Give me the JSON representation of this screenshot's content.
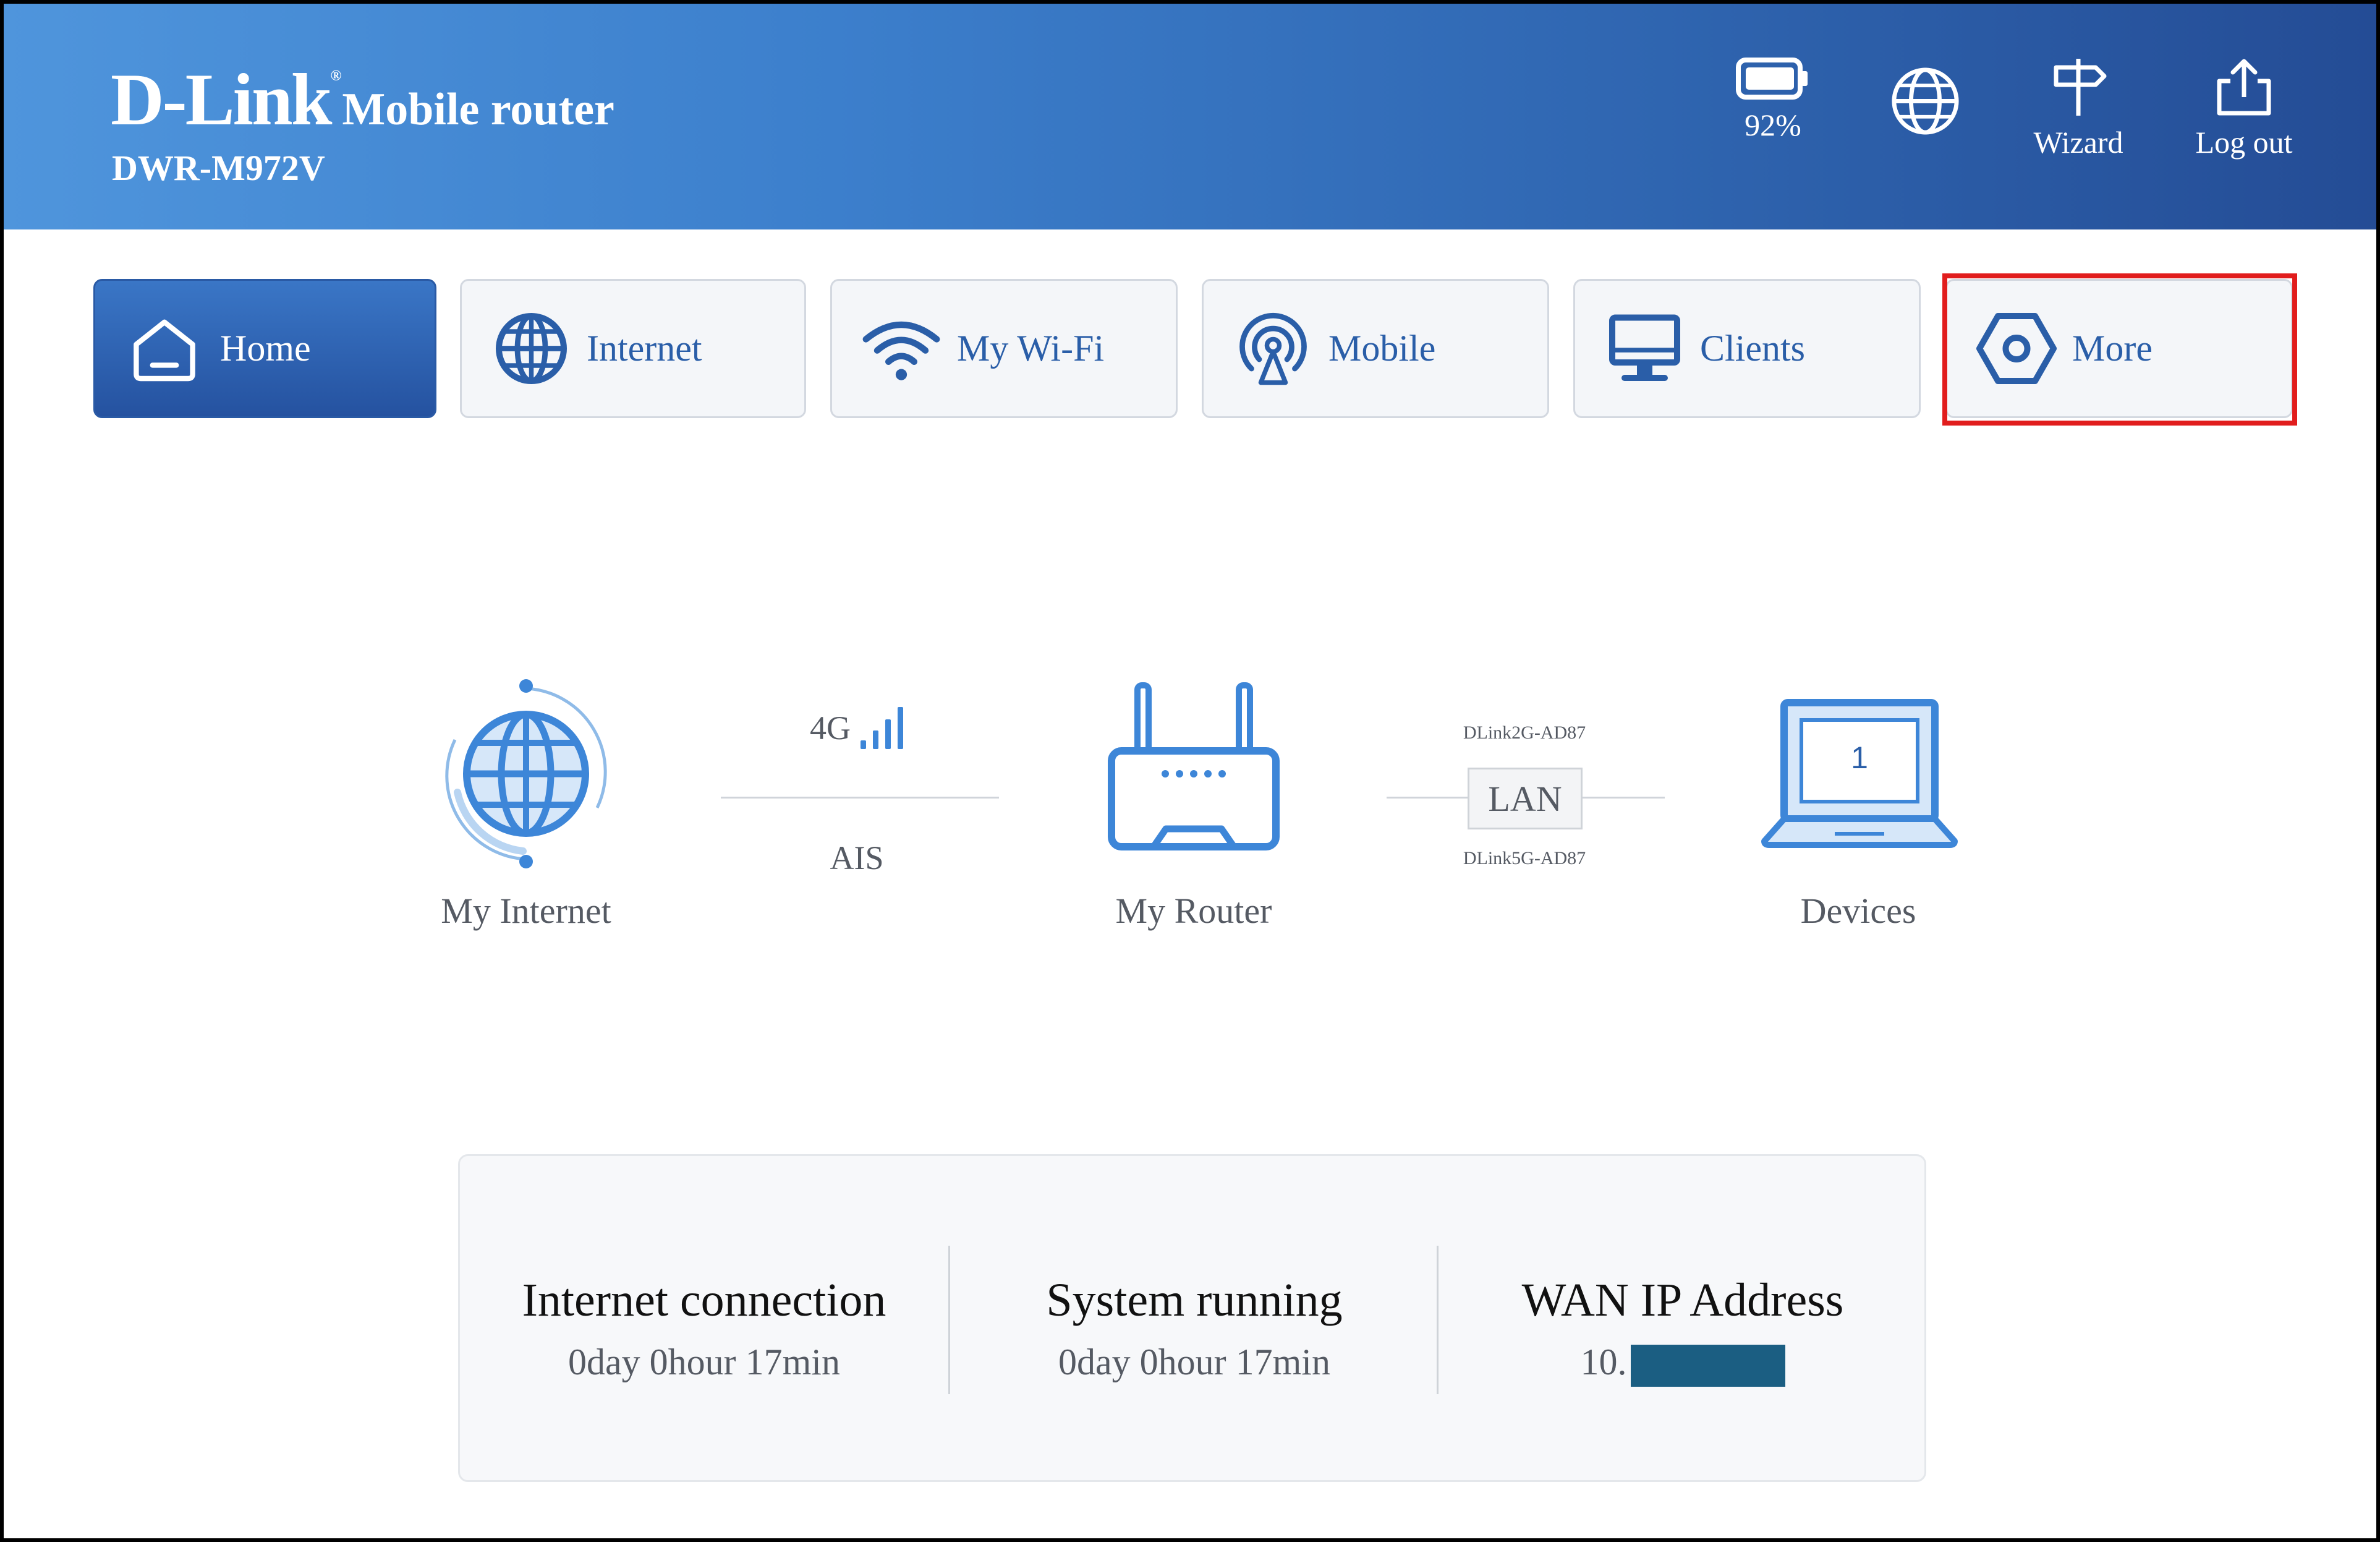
{
  "header": {
    "logo": "D-Link",
    "registered": "®",
    "product": "Mobile router",
    "model": "DWR-M972V",
    "battery": "92%",
    "wizard_label": "Wizard",
    "logout_label": "Log out"
  },
  "nav": {
    "tabs": [
      {
        "label": "Home",
        "icon": "home-icon",
        "active": true
      },
      {
        "label": "Internet",
        "icon": "globe-icon"
      },
      {
        "label": "My Wi-Fi",
        "icon": "wifi-icon"
      },
      {
        "label": "Mobile",
        "icon": "antenna-icon"
      },
      {
        "label": "Clients",
        "icon": "monitor-icon"
      },
      {
        "label": "More",
        "icon": "hexagon-icon",
        "highlighted": true
      }
    ]
  },
  "topology": {
    "internet_label": "My Internet",
    "network_type": "4G",
    "operator": "AIS",
    "router_label": "My Router",
    "ssid_2g": "DLink2G-AD87",
    "connection": "LAN",
    "ssid_5g": "DLink5G-AD87",
    "device_count": "1",
    "devices_label": "Devices"
  },
  "stats": {
    "internet_title": "Internet connection",
    "internet_value": "0day 0hour 17min",
    "system_title": "System running",
    "system_value": "0day 0hour 17min",
    "wan_title": "WAN IP Address",
    "wan_value": "10."
  },
  "colors": {
    "brand_blue": "#2a5ea8",
    "icon_blue": "#3d86d8",
    "highlight_red": "#e11d1d"
  }
}
